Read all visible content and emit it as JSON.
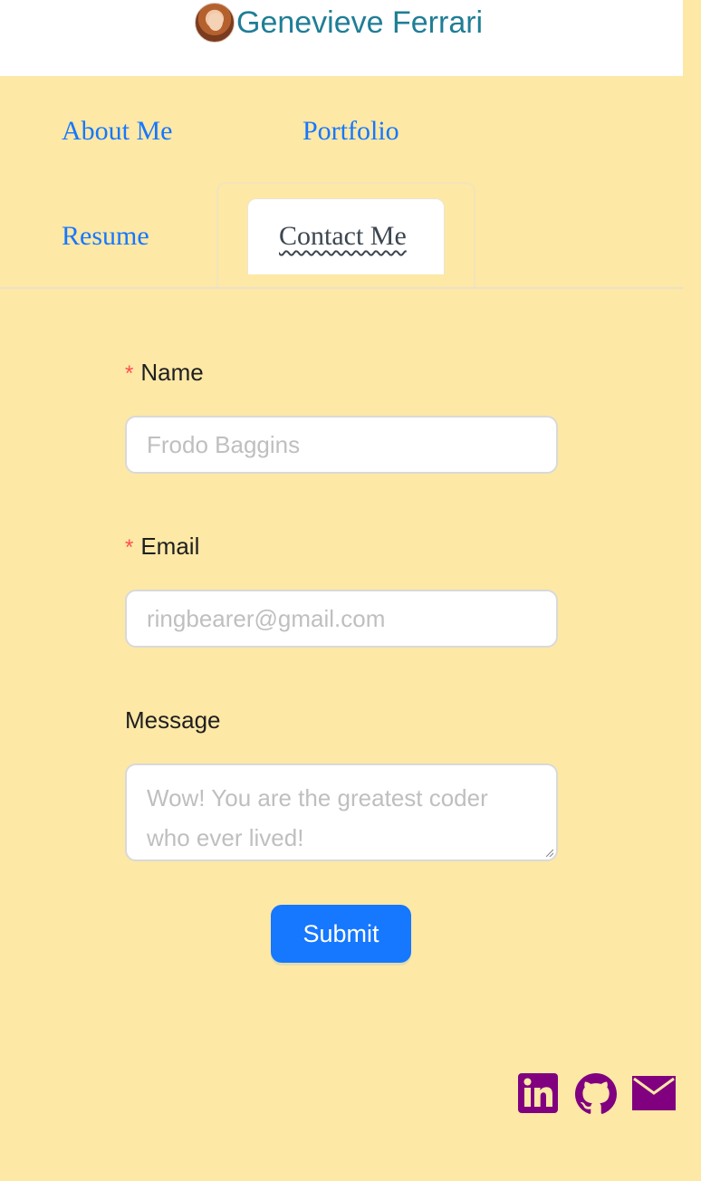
{
  "header": {
    "title": "Genevieve Ferrari",
    "avatar_icon": "profile-photo"
  },
  "nav": {
    "items": [
      {
        "label": "About Me"
      },
      {
        "label": "Portfolio"
      },
      {
        "label": "Resume"
      },
      {
        "label": "Contact Me",
        "active": true
      }
    ]
  },
  "form": {
    "name": {
      "label": "Name",
      "required": "*",
      "placeholder": "Frodo Baggins"
    },
    "email": {
      "label": "Email",
      "required": "*",
      "placeholder": "ringbearer@gmail.com"
    },
    "message": {
      "label": "Message",
      "placeholder": "Wow! You are the greatest coder who ever lived!"
    },
    "submit_label": "Submit"
  },
  "social": [
    {
      "icon": "linkedin-icon"
    },
    {
      "icon": "github-icon"
    },
    {
      "icon": "mail-icon"
    }
  ],
  "colors": {
    "background": "#fde8a6",
    "link": "#1677ff",
    "brand": "#1f7e96",
    "social": "#800080",
    "button": "#1677ff"
  }
}
